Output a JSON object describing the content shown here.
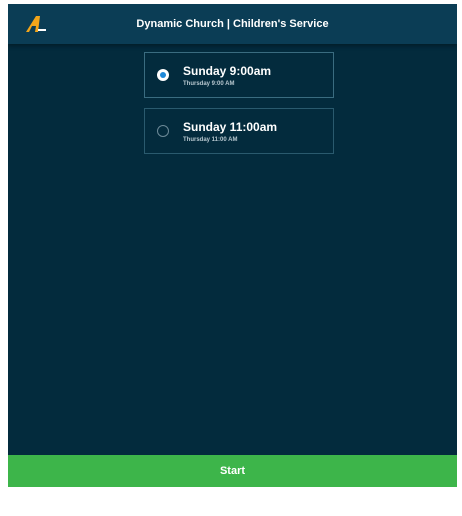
{
  "header": {
    "title": "Dynamic Church | Children's Service",
    "logo_icon": "app-logo-icon",
    "background": "#0b3d55"
  },
  "services": [
    {
      "name": "Sunday 9:00am",
      "subtitle": "Thursday 9:00 AM",
      "selected": true
    },
    {
      "name": "Sunday 11:00am",
      "subtitle": "Thursday 11:00 AM",
      "selected": false
    }
  ],
  "footer": {
    "start_label": "Start",
    "color": "#3db54a"
  },
  "colors": {
    "background": "#032b3d",
    "accent": "#1e88d8",
    "logo": "#f2a51a"
  }
}
